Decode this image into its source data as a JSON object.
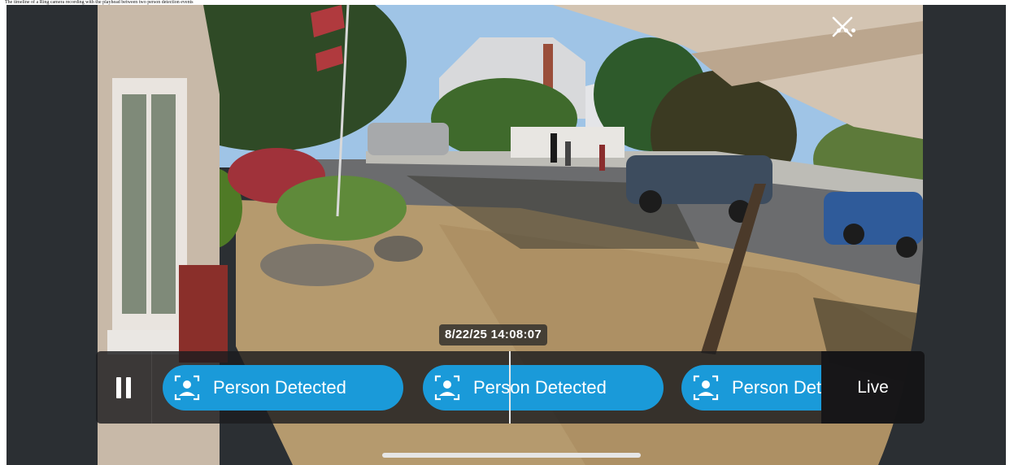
{
  "page_caption": "The timeline of a Ring camera recording with the playhead between two person detection events",
  "camera": {
    "more_label": "More options",
    "close_label": "Close"
  },
  "playback": {
    "timestamp": "8/22/25 14:08:07",
    "pause_label": "Pause",
    "live_label": "Live",
    "events": [
      {
        "label": "Person Detected",
        "icon": "person-detect-icon"
      },
      {
        "label": "Person Detected",
        "icon": "person-detect-icon"
      },
      {
        "label": "Person Detected",
        "icon": "person-detect-icon"
      }
    ]
  },
  "colors": {
    "event_pill": "#1a9ad9",
    "timeline_bg": "#1c1c1e",
    "frame_bg": "#2b2f33"
  }
}
